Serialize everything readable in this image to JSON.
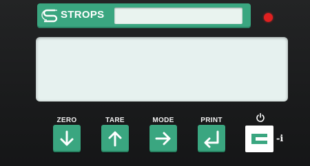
{
  "header": {
    "brand_name": "STROPS",
    "logo_icon": "strops-logo-icon",
    "label_window_text": "",
    "status_led": {
      "icon": "status-led-icon",
      "color": "#e02020"
    }
  },
  "display": {
    "text": ""
  },
  "keys": [
    {
      "label": "ZERO",
      "icon": "arrow-down-icon"
    },
    {
      "label": "TARE",
      "icon": "arrow-up-icon"
    },
    {
      "label": "MODE",
      "icon": "arrow-right-icon"
    },
    {
      "label": "PRINT",
      "icon": "enter-icon"
    }
  ],
  "clear_key": {
    "glyph_icon": "c-icon",
    "power_icon": "power-icon",
    "suffix": "-i"
  },
  "colors": {
    "panel": "#1d1e1f",
    "accent_green": "#3aa680",
    "display": "#e6f1ef",
    "led_red": "#e02020",
    "key_glyph": "#ffffff",
    "c_glyph": "#3aa680"
  }
}
